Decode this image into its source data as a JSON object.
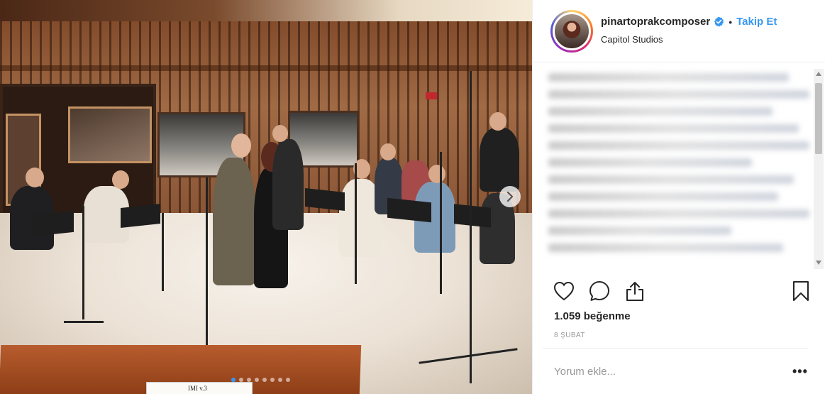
{
  "post": {
    "image": {
      "score_label": "IMI v.3",
      "carousel_count": 8,
      "carousel_active_index": 0
    },
    "header": {
      "username": "pinartoprakcomposer",
      "verified": true,
      "separator": "•",
      "follow_label": "Takip Et",
      "location": "Capitol Studios"
    },
    "caption": {
      "blurred": true
    },
    "actions": {
      "like_icon": "heart-outline-icon",
      "comment_icon": "comment-bubble-icon",
      "share_icon": "share-upload-icon",
      "save_icon": "bookmark-icon"
    },
    "likes_text": "1.059 beğenme",
    "date_text": "8 ŞUBAT",
    "comment": {
      "placeholder": "Yorum ekle...",
      "more_label": "•••"
    }
  },
  "colors": {
    "accent": "#3897f0",
    "verified": "#3897f0",
    "text": "#262626",
    "muted": "#999999",
    "divider": "#efefef"
  }
}
